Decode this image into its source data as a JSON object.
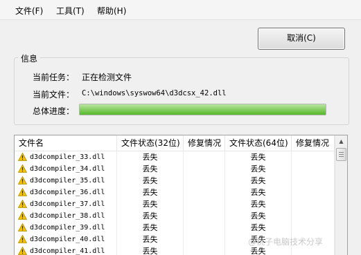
{
  "menu": {
    "file": "文件(F)",
    "tools": "工具(T)",
    "help": "帮助(H)"
  },
  "cancel_label": "取消(C)",
  "info": {
    "title": "信息",
    "task_label": "当前任务：",
    "task_value": "正在检测文件",
    "file_label": "当前文件：",
    "file_value": "C:\\windows\\syswow64\\d3dcsx_42.dll",
    "progress_label": "总体进度：",
    "progress_fraction": 1.0
  },
  "list": {
    "columns": [
      "文件名",
      "文件状态(32位)",
      "修复情况",
      "文件状态(64位)",
      "修复情况"
    ],
    "rows": [
      {
        "name": "d3dcompiler_33.dll",
        "status32": "丢失",
        "fix32": "",
        "status64": "丢失",
        "fix64": ""
      },
      {
        "name": "d3dcompiler_34.dll",
        "status32": "丢失",
        "fix32": "",
        "status64": "丢失",
        "fix64": ""
      },
      {
        "name": "d3dcompiler_35.dll",
        "status32": "丢失",
        "fix32": "",
        "status64": "丢失",
        "fix64": ""
      },
      {
        "name": "d3dcompiler_36.dll",
        "status32": "丢失",
        "fix32": "",
        "status64": "丢失",
        "fix64": ""
      },
      {
        "name": "d3dcompiler_37.dll",
        "status32": "丢失",
        "fix32": "",
        "status64": "丢失",
        "fix64": ""
      },
      {
        "name": "d3dcompiler_38.dll",
        "status32": "丢失",
        "fix32": "",
        "status64": "丢失",
        "fix64": ""
      },
      {
        "name": "d3dcompiler_39.dll",
        "status32": "丢失",
        "fix32": "",
        "status64": "丢失",
        "fix64": ""
      },
      {
        "name": "d3dcompiler_40.dll",
        "status32": "丢失",
        "fix32": "",
        "status64": "丢失",
        "fix64": ""
      },
      {
        "name": "d3dcompiler_41.dll",
        "status32": "丢失",
        "fix32": "",
        "status64": "丢失",
        "fix64": ""
      }
    ]
  },
  "watermark": "@桃子电脑技术分享",
  "colors": {
    "progress_fill": "#56b629",
    "warning_icon": "#f5c400"
  },
  "icons": {
    "row_status": "warning-icon",
    "scroll_up": "chevron-up-icon"
  }
}
